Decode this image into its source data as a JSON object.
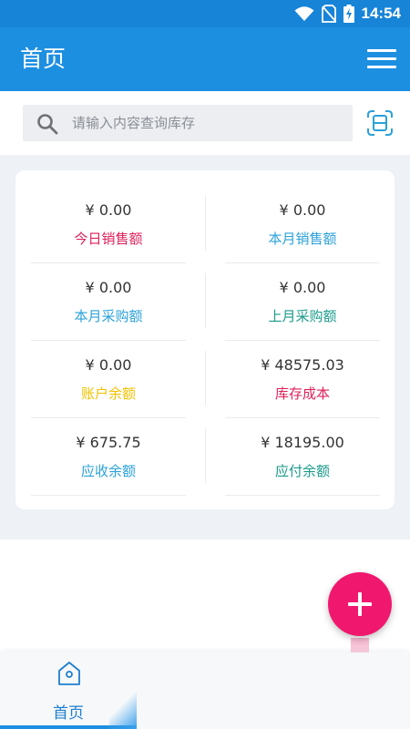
{
  "status_bar": {
    "time": "14:54"
  },
  "app_bar": {
    "title": "首页"
  },
  "search": {
    "placeholder": "请输入内容查询库存"
  },
  "stats": [
    {
      "value": "¥ 0.00",
      "label": "今日销售额",
      "color": "#e0205a"
    },
    {
      "value": "¥ 0.00",
      "label": "本月销售额",
      "color": "#2aa1d9"
    },
    {
      "value": "¥ 0.00",
      "label": "本月采购额",
      "color": "#2aa1d9"
    },
    {
      "value": "¥ 0.00",
      "label": "上月采购额",
      "color": "#1a9a8a"
    },
    {
      "value": "¥ 0.00",
      "label": "账户余额",
      "color": "#f2c200"
    },
    {
      "value": "¥ 48575.03",
      "label": "库存成本",
      "color": "#e0205a"
    },
    {
      "value": "¥ 675.75",
      "label": "应收余额",
      "color": "#2aa1d9"
    },
    {
      "value": "¥ 18195.00",
      "label": "应付余额",
      "color": "#1a9a8a"
    }
  ],
  "bottom_nav": {
    "items": [
      {
        "label": "首页",
        "icon": "home-icon",
        "active": true
      }
    ]
  },
  "colors": {
    "primary": "#1d8fe1",
    "status_bar": "#1784d8",
    "fab": "#f0186e",
    "background": "#eef1f5"
  }
}
